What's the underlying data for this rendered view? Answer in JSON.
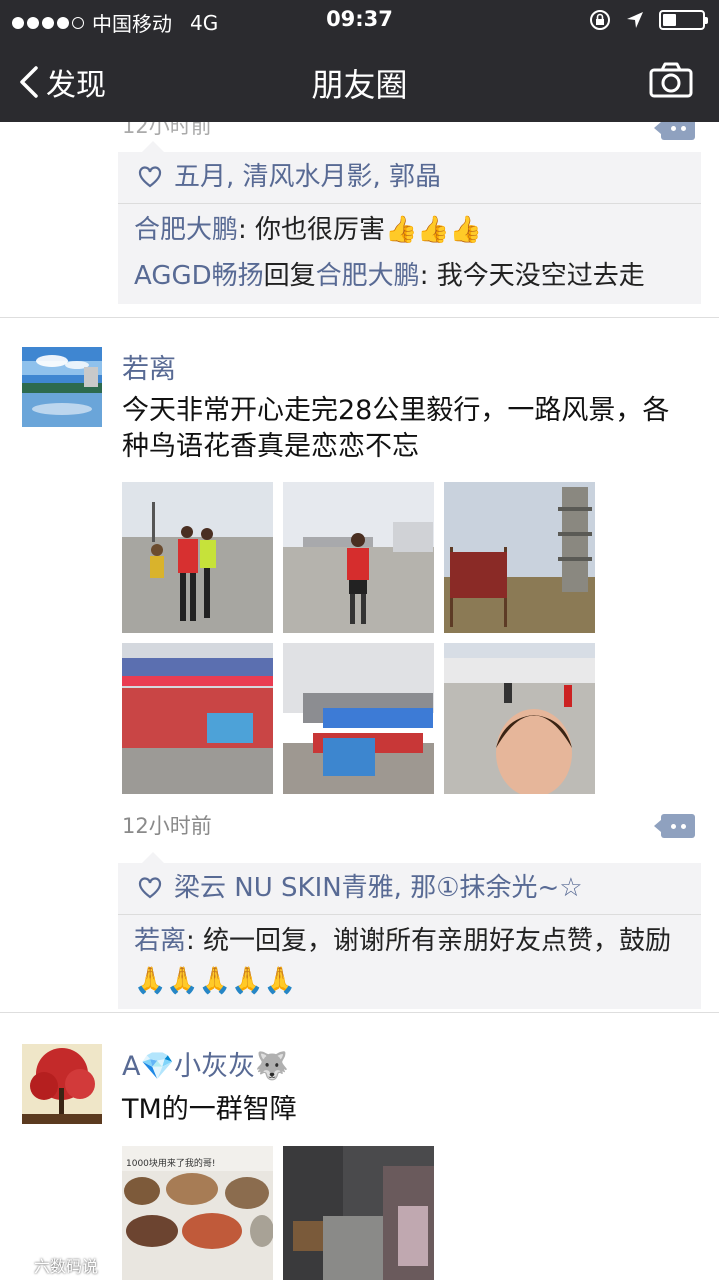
{
  "status_bar": {
    "carrier": "中国移动",
    "network": "4G",
    "time": "09:37",
    "signal_bars_filled": 4,
    "signal_bars_total": 5,
    "battery_level": 0.3
  },
  "nav": {
    "back_label": "发现",
    "title": "朋友圈",
    "camera_icon": "camera-icon"
  },
  "moment_prev": {
    "time_partial": "12小时前",
    "likes": "五月, 清风水月影, 郭晶",
    "comments": [
      {
        "who": "合肥大鹏",
        "sep": ": ",
        "text": "你也很厉害",
        "emoji": "👍👍👍"
      },
      {
        "who": "AGGD畅扬",
        "reply_word": "回复",
        "reply_to": "合肥大鹏",
        "sep": ": ",
        "text": "我今天没空过去走"
      }
    ]
  },
  "moment_main": {
    "name": "若离",
    "text": "今天非常开心走完28公里毅行，一路风景，各种鸟语花香真是恋恋不忘",
    "photo_count": 6,
    "time": "12小时前",
    "likes": "梁云 NU SKIN青雅, 那①抹余光~☆",
    "comments": [
      {
        "who": "若离",
        "sep": ": ",
        "text": "统一回复，谢谢所有亲朋好友点赞，鼓励",
        "emoji": "🙏🙏🙏🙏🙏"
      }
    ]
  },
  "moment_next": {
    "name": "A💎小灰灰🐺",
    "text": "TM的一群智障",
    "photo_caption": "1000块用来了我的哥!"
  },
  "watermark": "六数码说"
}
